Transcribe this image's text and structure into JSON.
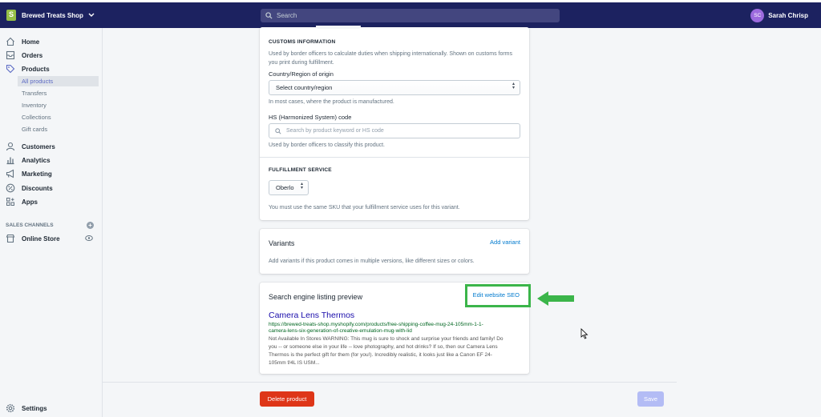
{
  "topbar": {
    "shop_name": "Brewed Treats Shop",
    "search_placeholder": "Search",
    "user_initials": "SC",
    "user_name": "Sarah Chrisp"
  },
  "sidebar": {
    "items": [
      {
        "label": "Home",
        "icon": "home-icon"
      },
      {
        "label": "Orders",
        "icon": "orders-icon"
      },
      {
        "label": "Products",
        "icon": "tag-icon"
      }
    ],
    "product_subitems": [
      "All products",
      "Transfers",
      "Inventory",
      "Collections",
      "Gift cards"
    ],
    "items2": [
      {
        "label": "Customers",
        "icon": "person-icon"
      },
      {
        "label": "Analytics",
        "icon": "bar-chart-icon"
      },
      {
        "label": "Marketing",
        "icon": "megaphone-icon"
      },
      {
        "label": "Discounts",
        "icon": "discount-icon"
      },
      {
        "label": "Apps",
        "icon": "apps-icon"
      }
    ],
    "sales_channels_label": "SALES CHANNELS",
    "online_store": "Online Store",
    "settings": "Settings"
  },
  "customs": {
    "title": "CUSTOMS INFORMATION",
    "description": "Used by border officers to calculate duties when shipping internationally. Shown on customs forms you print during fulfillment.",
    "country_label": "Country/Region of origin",
    "country_value": "Select country/region",
    "country_help": "In most cases, where the product is manufactured.",
    "hs_label": "HS (Harmonized System) code",
    "hs_placeholder": "Search by product keyword or HS code",
    "hs_help": "Used by border officers to classify this product."
  },
  "fulfillment": {
    "title": "FULFILLMENT SERVICE",
    "value": "Oberlo",
    "help": "You must use the same SKU that your fulfillment service uses for this variant."
  },
  "variants": {
    "title": "Variants",
    "add_link": "Add variant",
    "description": "Add variants if this product comes in multiple versions, like different sizes or colors."
  },
  "seo": {
    "title": "Search engine listing preview",
    "edit_link": "Edit website SEO",
    "preview_title": "Camera Lens Thermos",
    "preview_url_1": "https://brewed-treats-shop.myshopify.com/products/free-shipping-coffee-mug-24-105mm-1-1-",
    "preview_url_2": "camera-lens-six-generation-of-creative-emulation-mug-with-lid",
    "preview_desc_1": "Not Available In Stores WARNING: This mug is sure to shock and surprise your friends and family! Do",
    "preview_desc_2": "you -- or someone else in your life -- love photography, and hot drinks? If so, then our Camera Lens",
    "preview_desc_3": "Thermos is the perfect gift for them (for you!). Incredibly realistic, it looks just like a Canon EF 24-",
    "preview_desc_4": "105mm f/4L IS USM..."
  },
  "footer": {
    "delete_label": "Delete product",
    "save_label": "Save"
  },
  "colors": {
    "topbar": "#1c2260",
    "highlight": "#3bb54a",
    "delete": "#de3618",
    "save_disabled": "#b3bcf5"
  }
}
